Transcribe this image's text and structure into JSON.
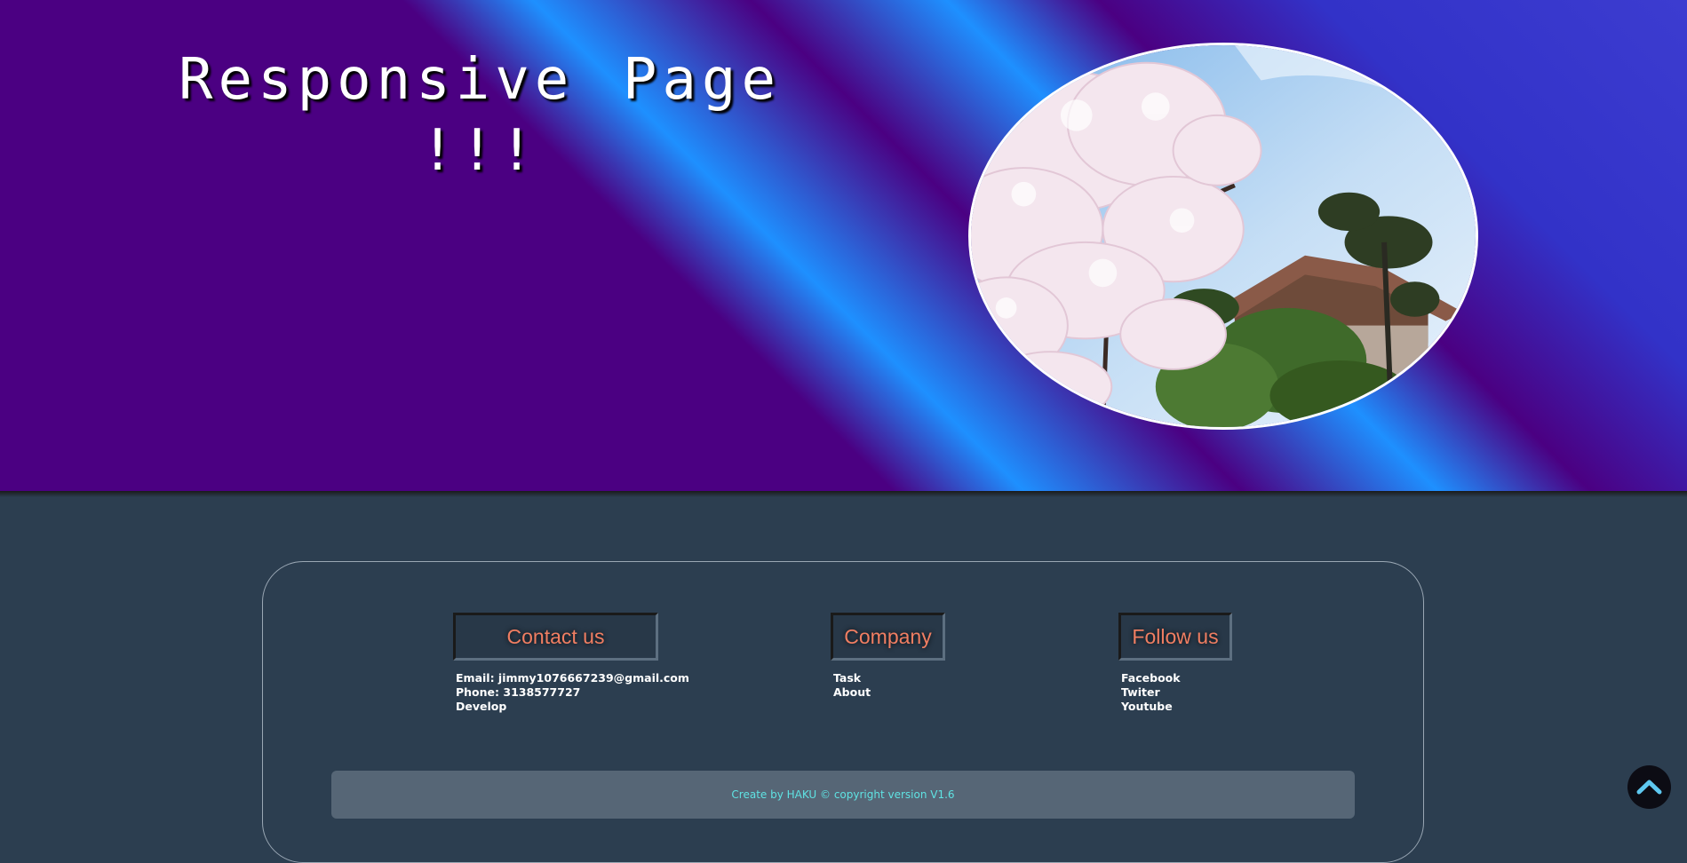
{
  "hero": {
    "title_line1": "Responsive Page",
    "title_line2": "!!!",
    "image_alt": "cherry blossoms and temple roof"
  },
  "footer": {
    "columns": [
      {
        "heading": "Contact us",
        "items": [
          "Email: jimmy1076667239@gmail.com",
          "Phone: 3138577727",
          "Develop"
        ]
      },
      {
        "heading": "Company",
        "items": [
          "Task",
          "About"
        ]
      },
      {
        "heading": "Follow us",
        "items": [
          "Facebook",
          "Twiter",
          "Youtube"
        ]
      }
    ],
    "copyright": "Create by HAKU © copyright version V1.6"
  },
  "scroll_top": {
    "icon": "chevron-up-icon"
  },
  "colors": {
    "hero_primary": "#4b0082",
    "hero_accent": "#1e90ff",
    "footer_bg": "#2c3e50",
    "heading_text": "#f07e62",
    "copyright_text": "#5fe3e3"
  }
}
